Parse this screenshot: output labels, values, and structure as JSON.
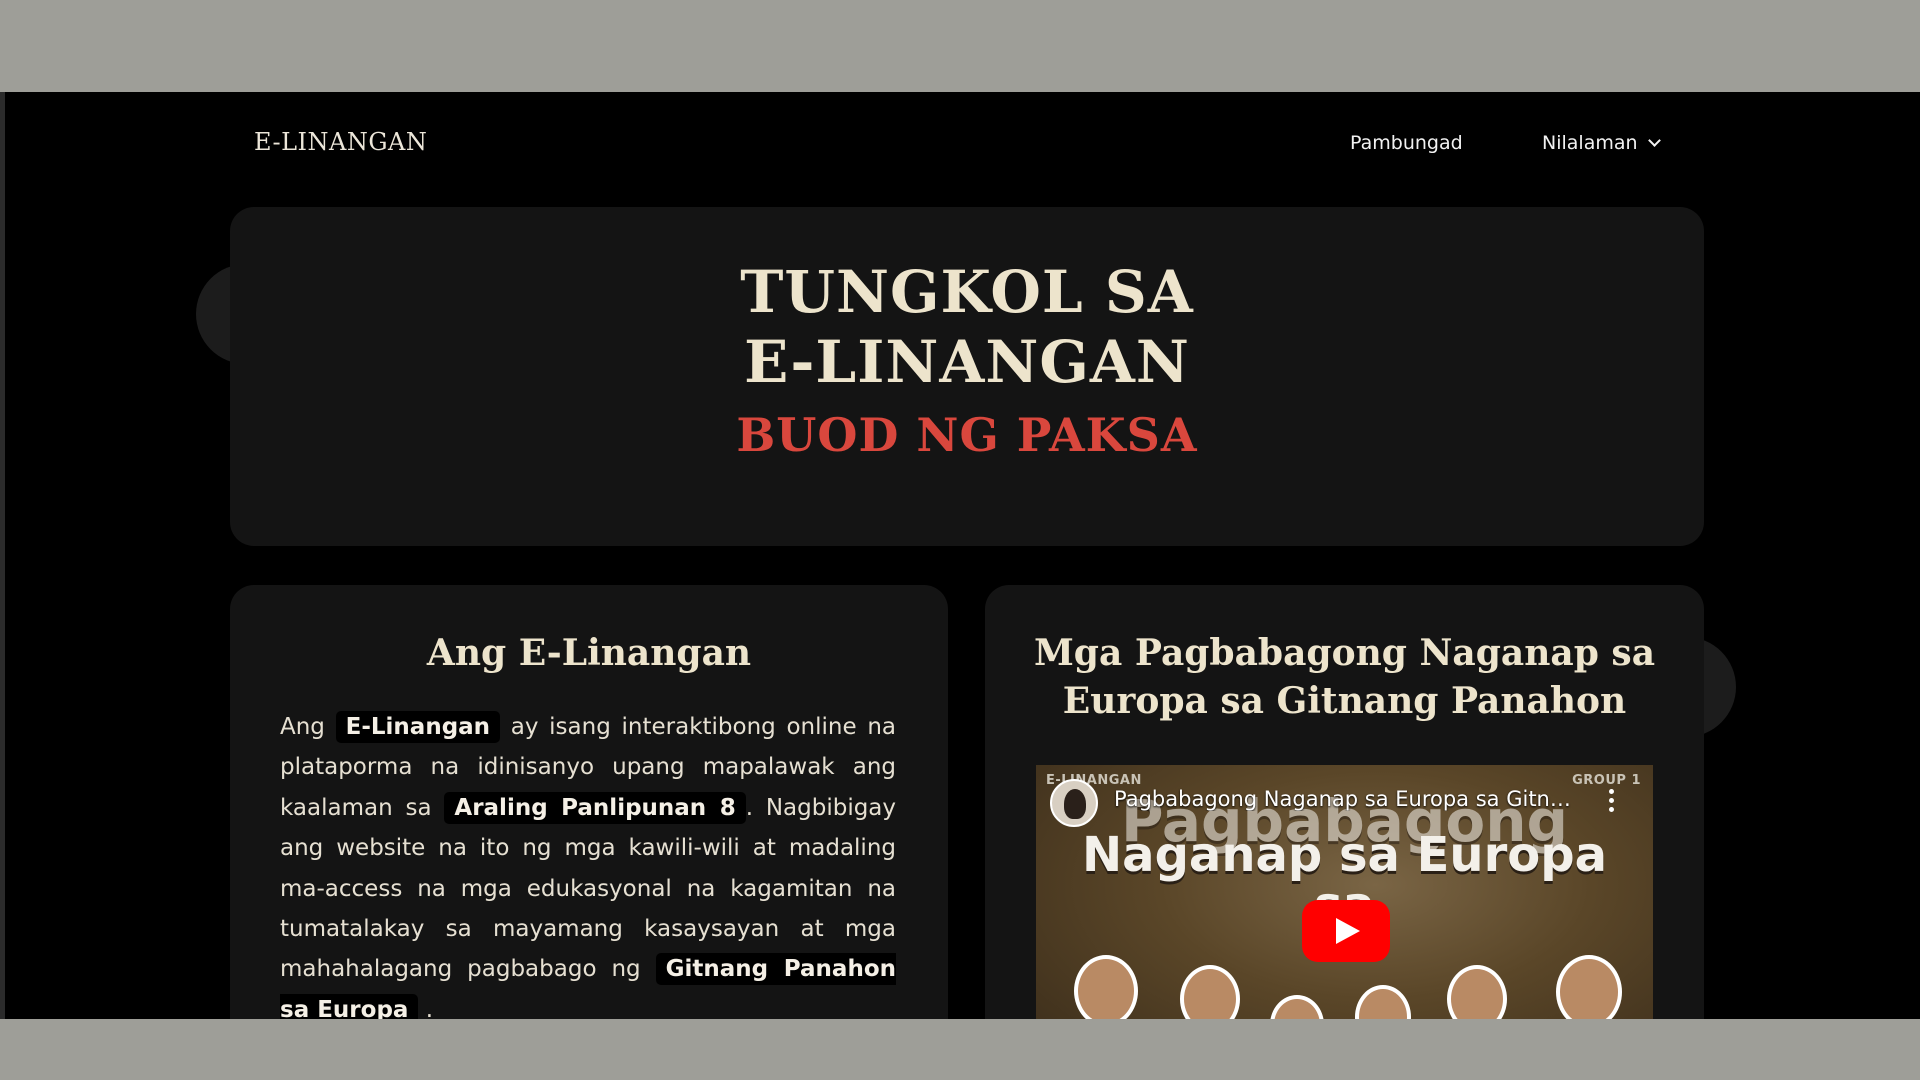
{
  "nav": {
    "brand": "E-LINANGAN",
    "home": "Pambungad",
    "content": "Nilalaman"
  },
  "hero": {
    "line1": "TUNGKOL SA",
    "line2": "E-LINANGAN",
    "subtitle": "BUOD NG PAKSA"
  },
  "about": {
    "title": "Ang E-Linangan",
    "p1": "Ang",
    "hl1": "E-Linangan",
    "p2": "ay isang interaktibong online na plataporma na idinisanyo upang mapalawak ang kaalaman sa",
    "hl2": "Araling Panlipunan 8",
    "p3": ". Nagbibigay ang website na ito ng mga kawili-wili at madaling ma-access na mga edukasyonal na kagamitan na tumatalakay sa mayamang kasaysayan at mga mahahalagang pagbabago ng",
    "hl3": "Gitnang Panahon sa Europa",
    "p4": "."
  },
  "video_card": {
    "title": "Mga Pagbabagong Naganap sa Europa sa Gitnang Panahon",
    "video": {
      "title": "Pagbabagong Naganap sa Europa sa Gitna...",
      "tag_left": "E-LINANGAN",
      "tag_right": "GROUP 1",
      "overlay1": "Pagbabagong",
      "overlay2": "Naganap sa Europa",
      "overlay3": "sa",
      "play_color": "#ff0000"
    }
  },
  "colors": {
    "background": "#000000",
    "card": "#141414",
    "heading": "#ede4cc",
    "accent": "#d9473d"
  }
}
